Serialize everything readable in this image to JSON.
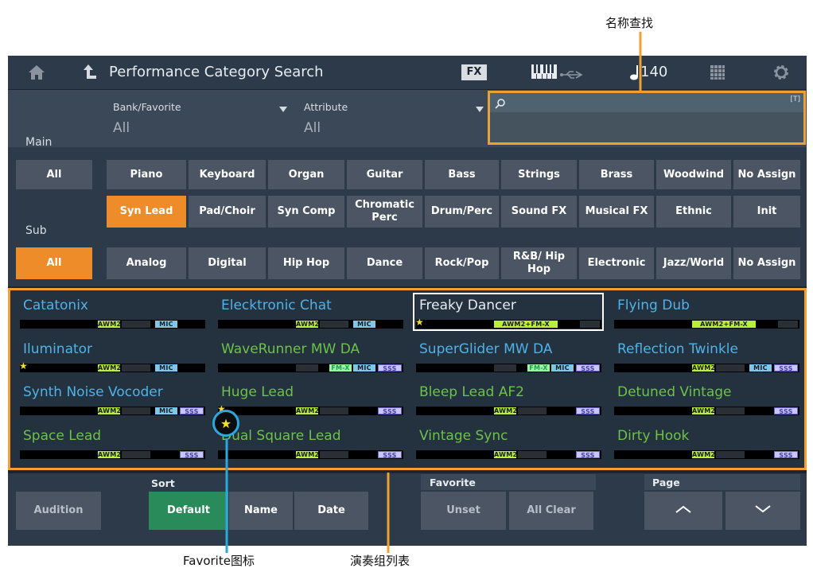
{
  "annotations": {
    "name_search": "名称查找",
    "favorite_icon": "Favorite图标",
    "performance_list": "演奏组列表"
  },
  "title_bar": {
    "title": "Performance Category Search",
    "fx_label": "FX",
    "tempo_value": "140"
  },
  "filters": {
    "bank_favorite": {
      "label": "Bank/Favorite",
      "value": "All"
    },
    "attribute": {
      "label": "Attribute",
      "value": "All"
    },
    "search": {
      "placeholder": "",
      "corner": "[T]"
    }
  },
  "main_row": {
    "row_label": "Main",
    "all": "All",
    "items": [
      "Piano",
      "Keyboard",
      "Organ",
      "Guitar",
      "Bass",
      "Strings",
      "Brass",
      "Woodwind"
    ],
    "extra": "No Assign"
  },
  "sub_category_row": {
    "items": [
      "Syn Lead",
      "Pad/Choir",
      "Syn Comp",
      "Chromatic Perc",
      "Drum/Perc",
      "Sound FX",
      "Musical FX",
      "Ethnic"
    ],
    "selected": "Syn Lead",
    "extra": "Init"
  },
  "sub_row": {
    "row_label": "Sub",
    "all": "All",
    "items": [
      "Analog",
      "Digital",
      "Hip Hop",
      "Dance",
      "Rock/Pop",
      "R&B/ Hip Hop",
      "Electronic",
      "Jazz/World"
    ],
    "extra": "No Assign"
  },
  "performances": [
    {
      "name": "Catatonix",
      "color": "#4fb2e8",
      "favorite": false,
      "selected": false,
      "awm": "AWM2",
      "fmx": "",
      "mic": "MIC",
      "ssv": ""
    },
    {
      "name": "Elecktronic Chat",
      "color": "#4fb2e8",
      "favorite": false,
      "selected": false,
      "awm": "AWM2",
      "fmx": "",
      "mic": "MIC",
      "ssv": ""
    },
    {
      "name": "Freaky Dancer",
      "color": "#e6ebf0",
      "favorite": true,
      "selected": true,
      "awm": "AWM2+FM-X",
      "fmx": "",
      "mic": "",
      "ssv": ""
    },
    {
      "name": "Flying Dub",
      "color": "#4fb2e8",
      "favorite": false,
      "selected": false,
      "awm": "AWM2+FM-X",
      "fmx": "",
      "mic": "",
      "ssv": ""
    },
    {
      "name": "Iluminator",
      "color": "#4fb2e8",
      "favorite": true,
      "selected": false,
      "awm": "AWM2",
      "fmx": "",
      "mic": "MIC",
      "ssv": ""
    },
    {
      "name": "WaveRunner MW DA",
      "color": "#6cc24a",
      "favorite": false,
      "selected": false,
      "awm": "",
      "fmx": "FM-X",
      "mic": "MIC",
      "ssv": "SSS"
    },
    {
      "name": "SuperGlider MW DA",
      "color": "#4fb2e8",
      "favorite": false,
      "selected": false,
      "awm": "",
      "fmx": "FM-X",
      "mic": "MIC",
      "ssv": "SSS"
    },
    {
      "name": "Reflection Twinkle",
      "color": "#4fb2e8",
      "favorite": false,
      "selected": false,
      "awm": "AWM2",
      "fmx": "",
      "mic": "MIC",
      "ssv": "SSS"
    },
    {
      "name": "Synth Noise Vocoder",
      "color": "#4fb2e8",
      "favorite": false,
      "selected": false,
      "awm": "AWM2",
      "fmx": "",
      "mic": "MIC",
      "ssv": "SSS"
    },
    {
      "name": "Huge Lead",
      "color": "#6cc24a",
      "favorite": true,
      "selected": false,
      "awm": "AWM2",
      "fmx": "",
      "mic": "",
      "ssv": "SSS"
    },
    {
      "name": "Bleep Lead AF2",
      "color": "#6cc24a",
      "favorite": false,
      "selected": false,
      "awm": "AWM2",
      "fmx": "",
      "mic": "",
      "ssv": "SSS"
    },
    {
      "name": "Detuned Vintage",
      "color": "#6cc24a",
      "favorite": false,
      "selected": false,
      "awm": "AWM2",
      "fmx": "",
      "mic": "",
      "ssv": "SSS"
    },
    {
      "name": "Space Lead",
      "color": "#6cc24a",
      "favorite": false,
      "selected": false,
      "awm": "AWM2",
      "fmx": "",
      "mic": "",
      "ssv": "SSS"
    },
    {
      "name": "Dual Square Lead",
      "color": "#6cc24a",
      "favorite": false,
      "selected": false,
      "awm": "AWM2",
      "fmx": "",
      "mic": "",
      "ssv": "SSS"
    },
    {
      "name": "Vintage Sync",
      "color": "#6cc24a",
      "favorite": false,
      "selected": false,
      "awm": "AWM2",
      "fmx": "",
      "mic": "",
      "ssv": "SSS"
    },
    {
      "name": "Dirty Hook",
      "color": "#6cc24a",
      "favorite": false,
      "selected": false,
      "awm": "AWM2",
      "fmx": "",
      "mic": "",
      "ssv": "SSS"
    }
  ],
  "bottom_bar": {
    "audition": "Audition",
    "sort_label": "Sort",
    "sort_default": "Default",
    "sort_name": "Name",
    "sort_date": "Date",
    "favorite_label": "Favorite",
    "unset": "Unset",
    "all_clear": "All Clear",
    "page_label": "Page"
  },
  "accent_colors": {
    "orange": "#ee8c2a",
    "green": "#2a8b5a",
    "annotation_orange": "#f0a030",
    "annotation_blue": "#2aa8e0"
  }
}
